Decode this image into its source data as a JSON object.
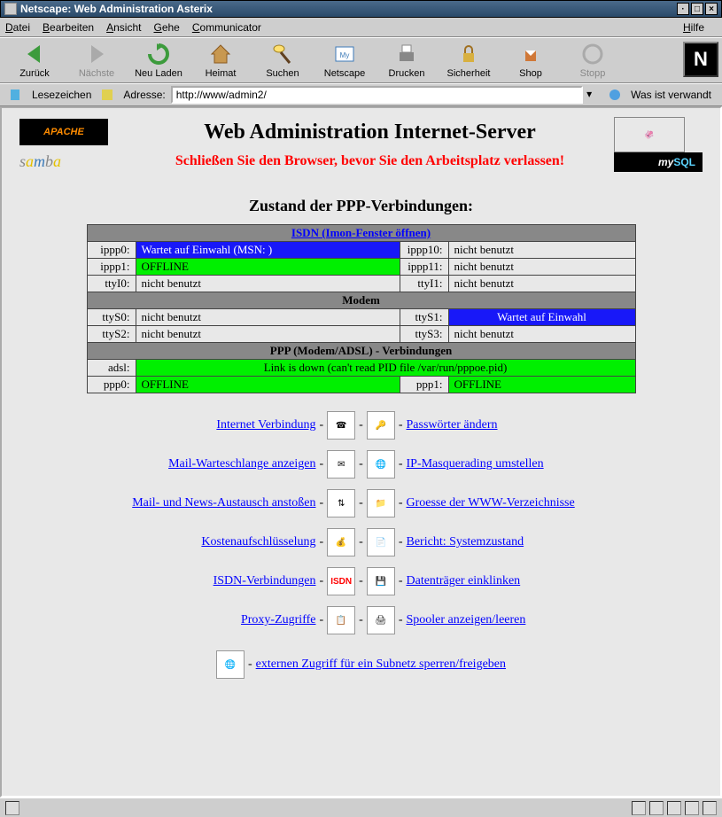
{
  "window": {
    "title": "Netscape: Web Administration Asterix"
  },
  "menu": {
    "datei": "Datei",
    "bearbeiten": "Bearbeiten",
    "ansicht": "Ansicht",
    "gehe": "Gehe",
    "communicator": "Communicator",
    "hilfe": "Hilfe"
  },
  "toolbar": {
    "zurueck": "Zurück",
    "naechste": "Nächste",
    "neuladen": "Neu Laden",
    "heimat": "Heimat",
    "suchen": "Suchen",
    "netscape": "Netscape",
    "drucken": "Drucken",
    "sicherheit": "Sicherheit",
    "shop": "Shop",
    "stopp": "Stopp"
  },
  "location": {
    "lesezeichen": "Lesezeichen",
    "adresse_label": "Adresse:",
    "url": "http://www/admin2/",
    "verwandt": "Was ist verwandt"
  },
  "page": {
    "title": "Web Administration Internet-Server",
    "warning": "Schließen Sie den Browser, bevor Sie den Arbeitsplatz verlassen!",
    "section_title": "Zustand der PPP-Verbindungen:",
    "logos": {
      "apache": "APACHE",
      "samba": "samba",
      "mysql_pre": "my",
      "mysql_post": "SQL"
    }
  },
  "table": {
    "isdn_header": "ISDN (Imon-Fenster öffnen)",
    "modem_header": "Modem",
    "ppp_header": "PPP (Modem/ADSL) - Verbindungen",
    "nicht_benutzt": "nicht benutzt",
    "offline": "OFFLINE",
    "wartet_msn": "Wartet auf Einwahl (MSN: )",
    "wartet": "Wartet auf Einwahl",
    "adsl_status": "Link is down (can't read PID file /var/run/pppoe.pid)",
    "labels": {
      "ippp0": "ippp0:",
      "ippp1": "ippp1:",
      "ippp10": "ippp10:",
      "ippp11": "ippp11:",
      "ttyI0": "ttyI0:",
      "ttyI1": "ttyI1:",
      "ttyS0": "ttyS0:",
      "ttyS1": "ttyS1:",
      "ttyS2": "ttyS2:",
      "ttyS3": "ttyS3:",
      "adsl": "adsl:",
      "ppp0": "ppp0:",
      "ppp1": "ppp1:"
    }
  },
  "links": {
    "internet": "Internet Verbindung ",
    "passwort": " Passwörter ändern",
    "mailq": "Mail-Warteschlange anzeigen ",
    "ipmasq": " IP-Masquerading umstellen",
    "mailnews": "Mail- und News-Austausch anstoßen ",
    "wwwsize": " Groesse der WWW-Verzeichnisse ",
    "kosten": "Kostenaufschlüsselung ",
    "bericht": " Bericht: Systemzustand ",
    "isdn": "ISDN-Verbindungen ",
    "datentraeger": " Datenträger einklinken ",
    "proxy": "Proxy-Zugriffe ",
    "spooler": " Spooler anzeigen/leeren ",
    "extern": " externen Zugriff für ein Subnetz sperren/freigeben "
  }
}
